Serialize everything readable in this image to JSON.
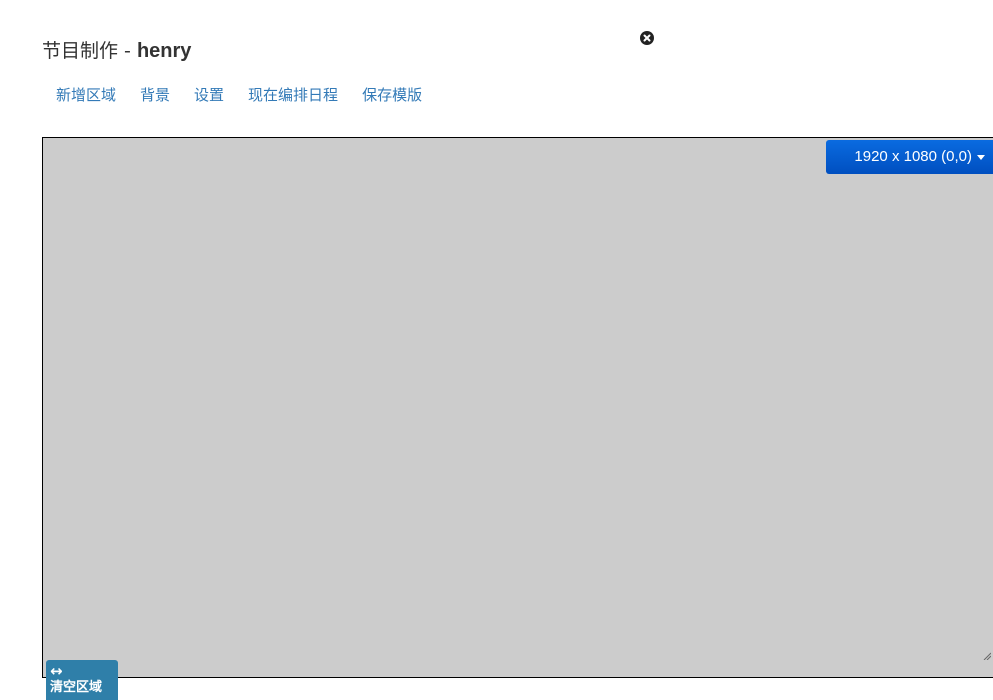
{
  "header": {
    "title_prefix": "节目制作 - ",
    "title_name": "henry"
  },
  "toolbar": {
    "items": [
      {
        "label": "新增区域"
      },
      {
        "label": "背景"
      },
      {
        "label": "设置"
      },
      {
        "label": "现在编排日程"
      },
      {
        "label": "保存模版"
      }
    ]
  },
  "canvas": {
    "background_color": "#cccccc",
    "resolution_label": "1920 x 1080 (0,0)",
    "resolution_button_color": "#0056cc"
  },
  "clear_button": {
    "arrow_glyph": "↔",
    "label": "清空区域",
    "color": "#2f7fa9"
  },
  "icons": {
    "close": "close-icon",
    "resize": "resize-handle-icon",
    "caret": "caret-down-icon",
    "arrows": "left-right-arrow-icon"
  },
  "colors": {
    "link": "#337ab7",
    "title": "#333333"
  }
}
